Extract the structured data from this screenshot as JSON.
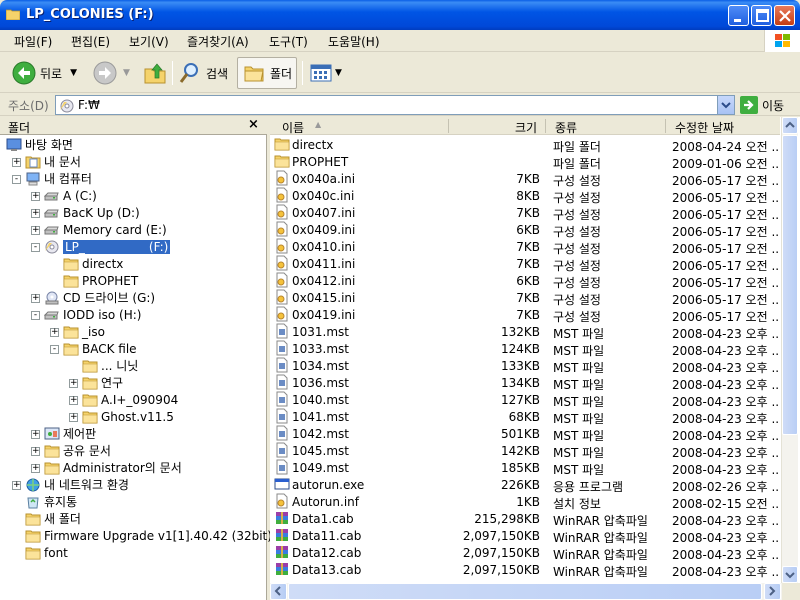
{
  "window": {
    "title": "LP_COLONIES (F:)"
  },
  "menu": [
    "파일(F)",
    "편집(E)",
    "보기(V)",
    "즐겨찾기(A)",
    "도구(T)",
    "도움말(H)"
  ],
  "toolbar": {
    "back_label": "뒤로",
    "search_label": "검색",
    "folders_label": "폴더"
  },
  "address": {
    "label": "주소(D)",
    "value": "F:₩",
    "go_label": "이동"
  },
  "folder_pane": {
    "title": "폴더",
    "close_glyph": "×",
    "items": [
      {
        "label": "바탕 화면",
        "icon": "desktop",
        "indent": 0,
        "exp": ""
      },
      {
        "label": "내 문서",
        "icon": "mydocs",
        "indent": 1,
        "exp": "+"
      },
      {
        "label": "내 컴퓨터",
        "icon": "computer",
        "indent": 1,
        "exp": "-"
      },
      {
        "label": "A (C:)",
        "icon": "drive",
        "indent": 2,
        "exp": "+"
      },
      {
        "label": "BacK Up (D:)",
        "icon": "drive",
        "indent": 2,
        "exp": "+"
      },
      {
        "label": "Memory card (E:)",
        "icon": "drive",
        "indent": 2,
        "exp": "+"
      },
      {
        "label": "LP_",
        "suffix": "(F:)",
        "icon": "cdrom",
        "indent": 2,
        "exp": "-",
        "selected": true
      },
      {
        "label": "directx",
        "icon": "folder",
        "indent": 3,
        "exp": ""
      },
      {
        "label": "PROPHET",
        "icon": "folder",
        "indent": 3,
        "exp": ""
      },
      {
        "label": "CD 드라이브 (G:)",
        "icon": "cd",
        "indent": 2,
        "exp": "+"
      },
      {
        "label": "IODD iso (H:)",
        "icon": "drive",
        "indent": 2,
        "exp": "-"
      },
      {
        "label": "_iso",
        "icon": "folder",
        "indent": 3,
        "exp": "+"
      },
      {
        "label": "BACK file",
        "icon": "folder",
        "indent": 3,
        "exp": "-"
      },
      {
        "label": "... 니닛",
        "icon": "folder",
        "indent": 4,
        "exp": ""
      },
      {
        "label": "연구",
        "icon": "folder",
        "indent": 4,
        "exp": "+"
      },
      {
        "label": "A.I+_090904",
        "icon": "folder",
        "indent": 4,
        "exp": "+"
      },
      {
        "label": "Ghost.v11.5",
        "icon": "folder",
        "indent": 4,
        "exp": "+"
      },
      {
        "label": "제어판",
        "icon": "control",
        "indent": 2,
        "exp": "+"
      },
      {
        "label": "공유 문서",
        "icon": "folder",
        "indent": 2,
        "exp": "+"
      },
      {
        "label": "Administrator의 문서",
        "icon": "folder",
        "indent": 2,
        "exp": "+"
      },
      {
        "label": "내 네트워크 환경",
        "icon": "network",
        "indent": 1,
        "exp": "+"
      },
      {
        "label": "휴지통",
        "icon": "recycle",
        "indent": 1,
        "exp": ""
      },
      {
        "label": "새 폴더",
        "icon": "folder",
        "indent": 1,
        "exp": ""
      },
      {
        "label": "Firmware Upgrade v1[1].40.42 (32bit)",
        "icon": "folder",
        "indent": 1,
        "exp": ""
      },
      {
        "label": "font",
        "icon": "folder",
        "indent": 1,
        "exp": ""
      }
    ]
  },
  "list": {
    "columns": [
      "이름",
      "크기",
      "종류",
      "수정한 날짜"
    ],
    "rows": [
      {
        "name": "directx",
        "size": "",
        "type": "파일 폴더",
        "date": "2008-04-24 오전 ...",
        "icon": "folder"
      },
      {
        "name": "PROPHET",
        "size": "",
        "type": "파일 폴더",
        "date": "2009-01-06 오전 ...",
        "icon": "folder"
      },
      {
        "name": "0x040a.ini",
        "size": "7KB",
        "type": "구성 설정",
        "date": "2006-05-17 오전 ...",
        "icon": "ini"
      },
      {
        "name": "0x040c.ini",
        "size": "8KB",
        "type": "구성 설정",
        "date": "2006-05-17 오전 ...",
        "icon": "ini"
      },
      {
        "name": "0x0407.ini",
        "size": "7KB",
        "type": "구성 설정",
        "date": "2006-05-17 오전 ...",
        "icon": "ini"
      },
      {
        "name": "0x0409.ini",
        "size": "6KB",
        "type": "구성 설정",
        "date": "2006-05-17 오전 ...",
        "icon": "ini"
      },
      {
        "name": "0x0410.ini",
        "size": "7KB",
        "type": "구성 설정",
        "date": "2006-05-17 오전 ...",
        "icon": "ini"
      },
      {
        "name": "0x0411.ini",
        "size": "7KB",
        "type": "구성 설정",
        "date": "2006-05-17 오전 ...",
        "icon": "ini"
      },
      {
        "name": "0x0412.ini",
        "size": "6KB",
        "type": "구성 설정",
        "date": "2006-05-17 오전 ...",
        "icon": "ini"
      },
      {
        "name": "0x0415.ini",
        "size": "7KB",
        "type": "구성 설정",
        "date": "2006-05-17 오전 ...",
        "icon": "ini"
      },
      {
        "name": "0x0419.ini",
        "size": "7KB",
        "type": "구성 설정",
        "date": "2006-05-17 오전 ...",
        "icon": "ini"
      },
      {
        "name": "1031.mst",
        "size": "132KB",
        "type": "MST 파일",
        "date": "2008-04-23 오후 ...",
        "icon": "mst"
      },
      {
        "name": "1033.mst",
        "size": "124KB",
        "type": "MST 파일",
        "date": "2008-04-23 오후 ...",
        "icon": "mst"
      },
      {
        "name": "1034.mst",
        "size": "133KB",
        "type": "MST 파일",
        "date": "2008-04-23 오후 ...",
        "icon": "mst"
      },
      {
        "name": "1036.mst",
        "size": "134KB",
        "type": "MST 파일",
        "date": "2008-04-23 오후 ...",
        "icon": "mst"
      },
      {
        "name": "1040.mst",
        "size": "127KB",
        "type": "MST 파일",
        "date": "2008-04-23 오후 ...",
        "icon": "mst"
      },
      {
        "name": "1041.mst",
        "size": "68KB",
        "type": "MST 파일",
        "date": "2008-04-23 오후 ...",
        "icon": "mst"
      },
      {
        "name": "1042.mst",
        "size": "501KB",
        "type": "MST 파일",
        "date": "2008-04-23 오후 ...",
        "icon": "mst"
      },
      {
        "name": "1045.mst",
        "size": "142KB",
        "type": "MST 파일",
        "date": "2008-04-23 오후 ...",
        "icon": "mst"
      },
      {
        "name": "1049.mst",
        "size": "185KB",
        "type": "MST 파일",
        "date": "2008-04-23 오후 ...",
        "icon": "mst"
      },
      {
        "name": "autorun.exe",
        "size": "226KB",
        "type": "응용 프로그램",
        "date": "2008-02-26 오후 ...",
        "icon": "exe"
      },
      {
        "name": "Autorun.inf",
        "size": "1KB",
        "type": "설치 정보",
        "date": "2008-02-15 오전 ...",
        "icon": "ini"
      },
      {
        "name": "Data1.cab",
        "size": "215,298KB",
        "type": "WinRAR 압축파일",
        "date": "2008-04-23 오후 ...",
        "icon": "rar"
      },
      {
        "name": "Data11.cab",
        "size": "2,097,150KB",
        "type": "WinRAR 압축파일",
        "date": "2008-04-23 오후 ...",
        "icon": "rar"
      },
      {
        "name": "Data12.cab",
        "size": "2,097,150KB",
        "type": "WinRAR 압축파일",
        "date": "2008-04-23 오후 ...",
        "icon": "rar"
      },
      {
        "name": "Data13.cab",
        "size": "2,097,150KB",
        "type": "WinRAR 압축파일",
        "date": "2008-04-23 오후 ...",
        "icon": "rar"
      }
    ]
  },
  "colors": {
    "title_blue": "#0055E5",
    "selection": "#316AC5",
    "folder": "#F5D36B"
  }
}
